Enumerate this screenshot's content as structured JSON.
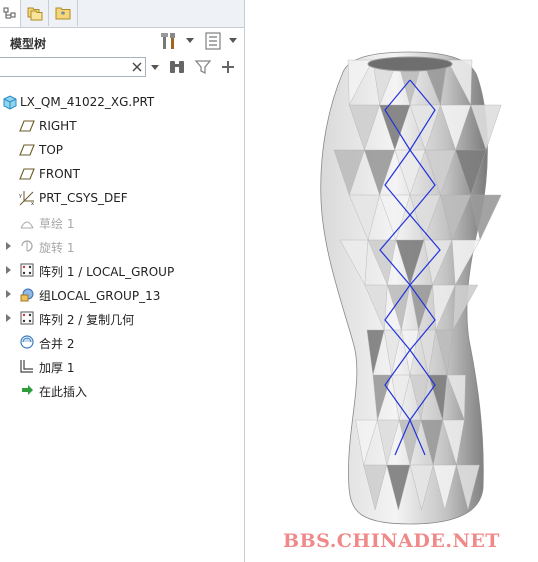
{
  "panel": {
    "title": "模型树",
    "tabs": [
      {
        "icon": "model-tree-tab-icon"
      },
      {
        "icon": "folder-browser-tab-icon"
      },
      {
        "icon": "favorites-tab-icon"
      }
    ],
    "search": {
      "value": "",
      "placeholder": ""
    }
  },
  "tree": {
    "root": "LX_QM_41022_XG.PRT",
    "items": [
      {
        "label": "RIGHT",
        "icon": "datum-plane-icon",
        "expandable": false,
        "disabled": false
      },
      {
        "label": "TOP",
        "icon": "datum-plane-icon",
        "expandable": false,
        "disabled": false
      },
      {
        "label": "FRONT",
        "icon": "datum-plane-icon",
        "expandable": false,
        "disabled": false
      },
      {
        "label": "PRT_CSYS_DEF",
        "icon": "coordinate-system-icon",
        "expandable": false,
        "disabled": false
      },
      {
        "label": "草绘 1",
        "icon": "sketch-icon",
        "expandable": false,
        "disabled": true
      },
      {
        "label": "旋转 1",
        "icon": "revolve-icon",
        "expandable": true,
        "disabled": true
      },
      {
        "label": "阵列 1 / LOCAL_GROUP",
        "icon": "pattern-icon",
        "expandable": true,
        "disabled": false
      },
      {
        "label": "组LOCAL_GROUP_13",
        "icon": "group-icon",
        "expandable": true,
        "disabled": false
      },
      {
        "label": "阵列 2 / 复制几何",
        "icon": "pattern-icon",
        "expandable": true,
        "disabled": false
      },
      {
        "label": "合并 2",
        "icon": "merge-icon",
        "expandable": false,
        "disabled": false
      },
      {
        "label": "加厚 1",
        "icon": "thicken-icon",
        "expandable": false,
        "disabled": false
      },
      {
        "label": "在此插入",
        "icon": "insert-here-arrow-icon",
        "expandable": false,
        "disabled": false
      }
    ]
  },
  "view": {
    "watermark": "BBS.CHINADE.NET"
  },
  "colors": {
    "selection_edge": "#2233dd",
    "watermark": "#f08a8a"
  }
}
